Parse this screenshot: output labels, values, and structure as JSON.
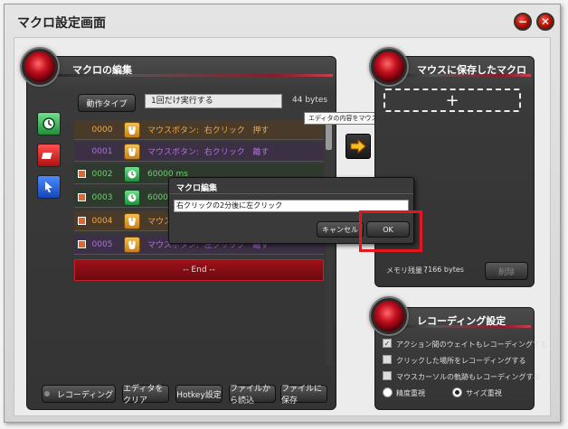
{
  "window": {
    "title": "マクロ設定画面",
    "min_label": "−",
    "close_label": "✕"
  },
  "edit_panel": {
    "title": "マクロの編集",
    "action_type_label": "動作タイプ",
    "exec_value": "1回だけ実行する",
    "bytes": "44 bytes",
    "rows": [
      {
        "num": "0000",
        "text": "マウスボタン:  右クリック   押す",
        "color": "#f0a840",
        "bg": "#4a3a2a",
        "icon": "mouse-icon",
        "checked": false
      },
      {
        "num": "0001",
        "text": "マウスボタン:  右クリック   離す",
        "color": "#b070e0",
        "bg": "#3c3044",
        "icon": "mouse-icon",
        "checked": false
      },
      {
        "num": "0002",
        "text": "60000 ms",
        "color": "#6ed06e",
        "bg": "#2e3a2e",
        "icon": "timer-icon",
        "checked": true
      },
      {
        "num": "0003",
        "text": "60000 ms",
        "color": "#6ed06e",
        "bg": "#2e3a2e",
        "icon": "timer-icon",
        "checked": true
      },
      {
        "num": "0004",
        "text": "マウスボタン:  左クリック   押す",
        "color": "#f0a840",
        "bg": "#4a3a2a",
        "icon": "mouse-icon",
        "checked": true
      },
      {
        "num": "0005",
        "text": "マウスボタン:  左クリック   離す",
        "color": "#b070e0",
        "bg": "#3c3044",
        "icon": "mouse-icon",
        "checked": true
      }
    ],
    "end_label": "-- End --",
    "bottom_buttons": [
      "レコーディング",
      "エディタをクリア",
      "Hotkey設定",
      "ファイルから読込",
      "ファイルに保存"
    ]
  },
  "tooltip": "エディタの内容をマウスに保存します。",
  "mouse_panel": {
    "title": "マウスに保存したマクロ",
    "add_label": "+",
    "memory_label": "メモリ残量 :",
    "memory_value": "7166 bytes",
    "delete_label": "削除"
  },
  "recording_panel": {
    "title": "レコーディング設定",
    "options": [
      {
        "label": "アクション間のウェイトもレコーディングする",
        "checked": true
      },
      {
        "label": "クリックした場所をレコーディングする",
        "checked": false
      },
      {
        "label": "マウスカーソルの軌跡もレコーディングする",
        "checked": false
      }
    ],
    "radio_precision": "精度重視",
    "radio_size": "サイズ重視"
  },
  "dialog": {
    "title": "マクロ編集",
    "input_value": "右クリックの2分後に左クリック",
    "cancel_label": "キャンセル",
    "ok_label": "OK"
  },
  "colors": {
    "highlight_box": "#e8141e",
    "end_bar": "#8a0e14",
    "accent_orange": "#f0a840"
  }
}
